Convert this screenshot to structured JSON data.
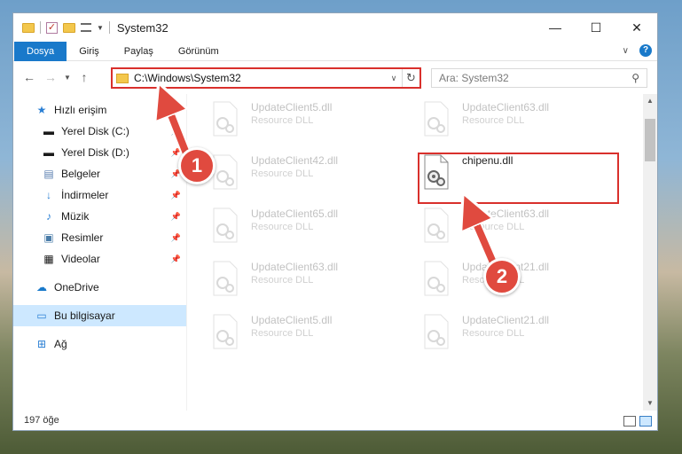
{
  "window": {
    "title": "System32",
    "controls": {
      "minimize": "—",
      "maximize": "☐",
      "close": "✕"
    }
  },
  "ribbon": {
    "tabs": [
      "Dosya",
      "Giriş",
      "Paylaş",
      "Görünüm"
    ]
  },
  "navbar": {
    "address": "C:\\Windows\\System32",
    "search_placeholder": "Ara: System32"
  },
  "sidebar": {
    "items": [
      {
        "label": "Hızlı erişim",
        "icon": "star-icon",
        "pinned": false
      },
      {
        "label": "Yerel Disk (C:)",
        "icon": "drive-icon",
        "pinned": true
      },
      {
        "label": "Yerel Disk (D:)",
        "icon": "drive-icon",
        "pinned": true
      },
      {
        "label": "Belgeler",
        "icon": "documents-icon",
        "pinned": true
      },
      {
        "label": "İndirmeler",
        "icon": "download-icon",
        "pinned": true
      },
      {
        "label": "Müzik",
        "icon": "music-icon",
        "pinned": true
      },
      {
        "label": "Resimler",
        "icon": "pictures-icon",
        "pinned": true
      },
      {
        "label": "Videolar",
        "icon": "video-icon",
        "pinned": true
      },
      {
        "label": "OneDrive",
        "icon": "cloud-icon",
        "pinned": false
      },
      {
        "label": "Bu bilgisayar",
        "icon": "computer-icon",
        "pinned": false,
        "selected": true
      },
      {
        "label": "Ağ",
        "icon": "network-icon",
        "pinned": false
      }
    ]
  },
  "files": [
    {
      "name": "UpdateClient5.dll",
      "desc": "Resource DLL"
    },
    {
      "name": "UpdateClient63.dll",
      "desc": "Resource DLL"
    },
    {
      "name": "UpdateClient42.dll",
      "desc": "Resource DLL"
    },
    {
      "name": "chipenu.dll",
      "desc": "",
      "highlighted": true
    },
    {
      "name": "UpdateClient65.dll",
      "desc": "Resource DLL"
    },
    {
      "name": "UpdateClient63.dll",
      "desc": "Resource DLL"
    },
    {
      "name": "UpdateClient63.dll",
      "desc": "Resource DLL"
    },
    {
      "name": "UpdateClient21.dll",
      "desc": "Resource DLL"
    },
    {
      "name": "UpdateClient5.dll",
      "desc": "Resource DLL"
    },
    {
      "name": "UpdateClient21.dll",
      "desc": "Resource DLL"
    }
  ],
  "status": {
    "count": "197 öğe"
  },
  "annotations": {
    "step1": "1",
    "step2": "2"
  },
  "colors": {
    "accent": "#1979ca",
    "highlight": "#d9302c",
    "badge": "#e04a3f"
  }
}
